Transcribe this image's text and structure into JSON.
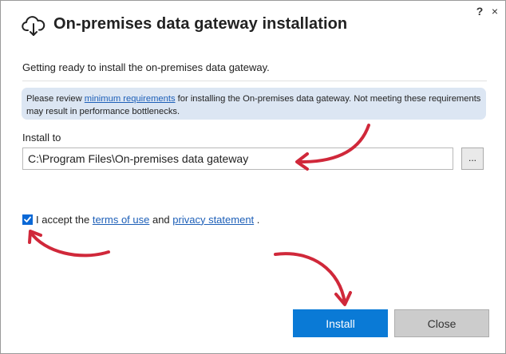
{
  "window": {
    "title": "On-premises data gateway installation",
    "help_label": "?",
    "close_label": "×"
  },
  "main": {
    "subtitle": "Getting ready to install the on-premises data gateway.",
    "info": {
      "prefix": "Please review ",
      "link": "minimum requirements",
      "suffix": " for installing the On-premises data gateway. Not meeting these requirements may result in performance bottlenecks."
    },
    "install_to_label": "Install to",
    "install_path": "C:\\Program Files\\On-premises data gateway",
    "browse_label": "...",
    "accept": {
      "prefix": "I accept the ",
      "terms_link": "terms of use",
      "middle": " and ",
      "privacy_link": "privacy statement",
      "suffix": " .",
      "checked": true
    }
  },
  "buttons": {
    "install": "Install",
    "close": "Close"
  },
  "colors": {
    "accent": "#0a7ad6",
    "info_background": "#dce6f3",
    "annotation_arrow": "#d0283a"
  },
  "icons": {
    "title": "cloud-download-icon",
    "checkbox": "checkmark-icon"
  }
}
